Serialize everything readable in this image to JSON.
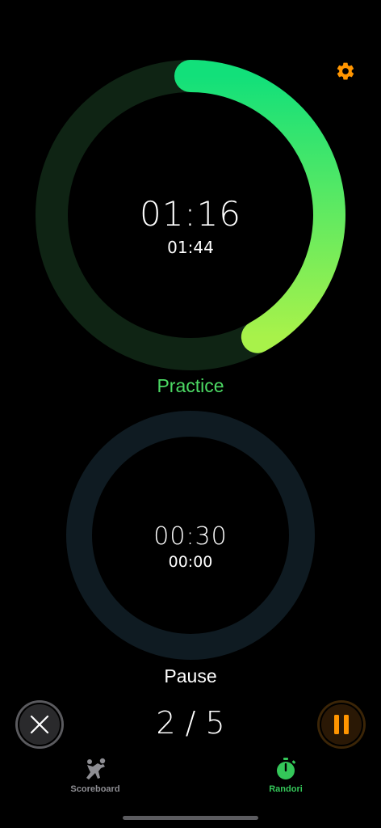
{
  "colors": {
    "practice_track": "#0f2414",
    "practice_grad_start": "#12e07a",
    "practice_grad_end": "#a8f24a",
    "practice_label": "#4cd964",
    "pause_track": "#0f1b22",
    "accent_orange": "#ff9500",
    "tab_active": "#34c759",
    "tab_inactive": "#8e8e93"
  },
  "practice": {
    "elapsed": "01:16",
    "remaining": "01:44",
    "label": "Practice",
    "progress": 0.42
  },
  "pause": {
    "elapsed": "00:30",
    "remaining": "00:00",
    "label": "Pause",
    "progress": 0
  },
  "controls": {
    "cancel_icon": "close-icon",
    "pause_icon": "pause-icon",
    "round_counter": "2 / 5"
  },
  "settings_icon": "gear-icon",
  "tabs": [
    {
      "label": "Scoreboard",
      "icon": "judo-throw-icon",
      "active": false
    },
    {
      "label": "Randori",
      "icon": "stopwatch-icon",
      "active": true
    }
  ]
}
